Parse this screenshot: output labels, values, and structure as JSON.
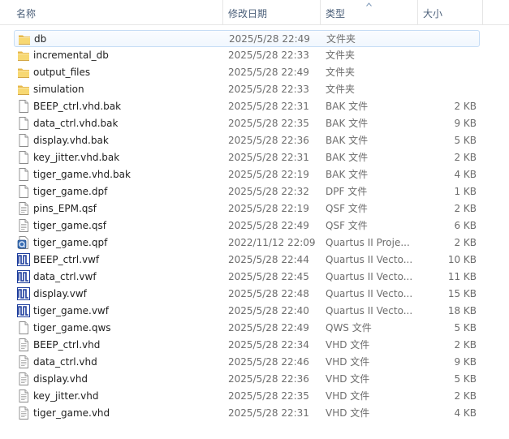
{
  "columns": {
    "name": "名称",
    "date": "修改日期",
    "type": "类型",
    "size": "大小"
  },
  "files": [
    {
      "name": "db",
      "date": "2025/5/28 22:49",
      "type": "文件夹",
      "size": "",
      "icon": "folder-icon",
      "selected": true
    },
    {
      "name": "incremental_db",
      "date": "2025/5/28 22:33",
      "type": "文件夹",
      "size": "",
      "icon": "folder-icon"
    },
    {
      "name": "output_files",
      "date": "2025/5/28 22:49",
      "type": "文件夹",
      "size": "",
      "icon": "folder-icon"
    },
    {
      "name": "simulation",
      "date": "2025/5/28 22:33",
      "type": "文件夹",
      "size": "",
      "icon": "folder-icon"
    },
    {
      "name": "BEEP_ctrl.vhd.bak",
      "date": "2025/5/28 22:31",
      "type": "BAK 文件",
      "size": "2 KB",
      "icon": "file-icon"
    },
    {
      "name": "data_ctrl.vhd.bak",
      "date": "2025/5/28 22:35",
      "type": "BAK 文件",
      "size": "9 KB",
      "icon": "file-icon"
    },
    {
      "name": "display.vhd.bak",
      "date": "2025/5/28 22:36",
      "type": "BAK 文件",
      "size": "5 KB",
      "icon": "file-icon"
    },
    {
      "name": "key_jitter.vhd.bak",
      "date": "2025/5/28 22:31",
      "type": "BAK 文件",
      "size": "2 KB",
      "icon": "file-icon"
    },
    {
      "name": "tiger_game.vhd.bak",
      "date": "2025/5/28 22:19",
      "type": "BAK 文件",
      "size": "4 KB",
      "icon": "file-icon"
    },
    {
      "name": "tiger_game.dpf",
      "date": "2025/5/28 22:32",
      "type": "DPF 文件",
      "size": "1 KB",
      "icon": "file-icon"
    },
    {
      "name": "pins_EPM.qsf",
      "date": "2025/5/28 22:19",
      "type": "QSF 文件",
      "size": "2 KB",
      "icon": "text-file-icon"
    },
    {
      "name": "tiger_game.qsf",
      "date": "2025/5/28 22:49",
      "type": "QSF 文件",
      "size": "6 KB",
      "icon": "text-file-icon"
    },
    {
      "name": "tiger_game.qpf",
      "date": "2022/11/12 22:09",
      "type": "Quartus II Proje...",
      "size": "2 KB",
      "icon": "quartus-project-icon"
    },
    {
      "name": "BEEP_ctrl.vwf",
      "date": "2025/5/28 22:44",
      "type": "Quartus II Vecto...",
      "size": "10 KB",
      "icon": "waveform-icon"
    },
    {
      "name": "data_ctrl.vwf",
      "date": "2025/5/28 22:45",
      "type": "Quartus II Vecto...",
      "size": "11 KB",
      "icon": "waveform-icon"
    },
    {
      "name": "display.vwf",
      "date": "2025/5/28 22:48",
      "type": "Quartus II Vecto...",
      "size": "15 KB",
      "icon": "waveform-icon"
    },
    {
      "name": "tiger_game.vwf",
      "date": "2025/5/28 22:40",
      "type": "Quartus II Vecto...",
      "size": "18 KB",
      "icon": "waveform-icon"
    },
    {
      "name": "tiger_game.qws",
      "date": "2025/5/28 22:49",
      "type": "QWS 文件",
      "size": "5 KB",
      "icon": "file-icon"
    },
    {
      "name": "BEEP_ctrl.vhd",
      "date": "2025/5/28 22:34",
      "type": "VHD 文件",
      "size": "2 KB",
      "icon": "text-file-icon"
    },
    {
      "name": "data_ctrl.vhd",
      "date": "2025/5/28 22:46",
      "type": "VHD 文件",
      "size": "9 KB",
      "icon": "text-file-icon"
    },
    {
      "name": "display.vhd",
      "date": "2025/5/28 22:36",
      "type": "VHD 文件",
      "size": "5 KB",
      "icon": "text-file-icon"
    },
    {
      "name": "key_jitter.vhd",
      "date": "2025/5/28 22:35",
      "type": "VHD 文件",
      "size": "2 KB",
      "icon": "text-file-icon"
    },
    {
      "name": "tiger_game.vhd",
      "date": "2025/5/28 22:31",
      "type": "VHD 文件",
      "size": "4 KB",
      "icon": "text-file-icon"
    }
  ]
}
